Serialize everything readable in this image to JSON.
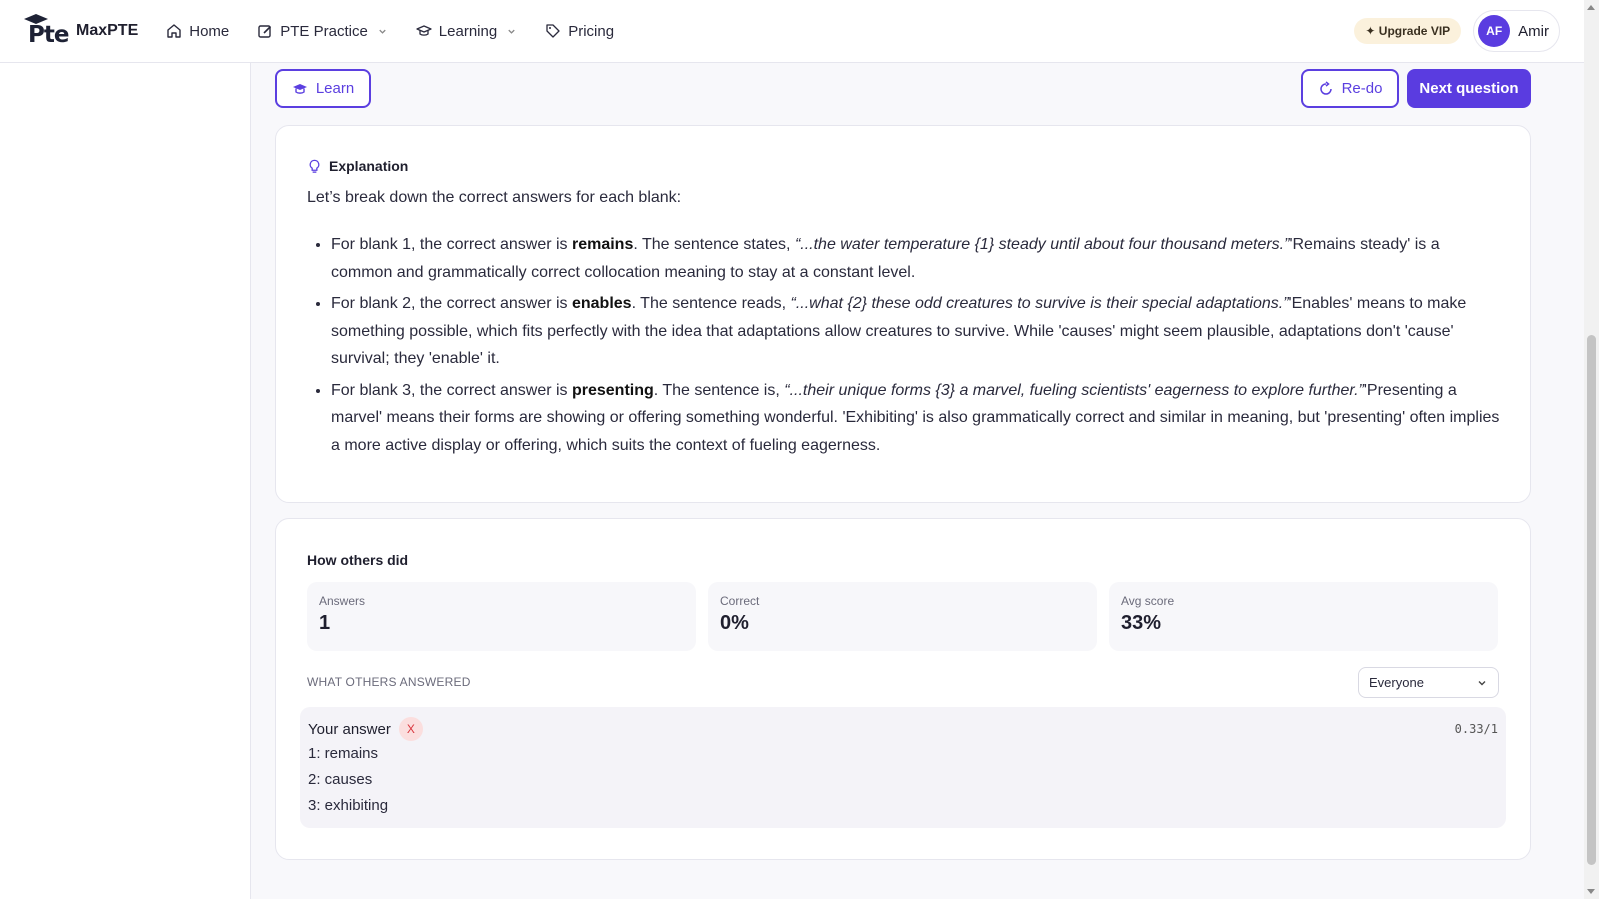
{
  "nav": {
    "brand": "MaxPTE",
    "logo_text": "Pte",
    "links": [
      {
        "label": "Home",
        "icon": "home-icon"
      },
      {
        "label": "PTE Practice",
        "icon": "edit-icon"
      },
      {
        "label": "Learning",
        "icon": "graduation-cap-icon"
      },
      {
        "label": "Pricing",
        "icon": "tag-icon"
      }
    ],
    "upgrade_label": "✦ Upgrade VIP",
    "avatar_initials": "AF",
    "user_name": "Amir"
  },
  "actions": {
    "learn_label": "Learn",
    "redo_label": "Re-do",
    "next_label": "Next question"
  },
  "explanation": {
    "title": "Explanation",
    "intro": "Let’s break down the correct answers for each blank:",
    "items": [
      {
        "pre": "For blank 1, the correct answer is ",
        "answer": "remains",
        "mid": ". The sentence states, ",
        "quote": "“...the water temperature {1} steady until about four thousand meters.”",
        "post": "'Remains steady' is a common and grammatically correct collocation meaning to stay at a constant level."
      },
      {
        "pre": "For blank 2, the correct answer is ",
        "answer": "enables",
        "mid": ". The sentence reads, ",
        "quote": "“...what {2} these odd creatures to survive is their special adaptations.”",
        "post": "'Enables' means to make something possible, which fits perfectly with the idea that adaptations allow creatures to survive. While 'causes' might seem plausible, adaptations don't 'cause' survival; they 'enable' it."
      },
      {
        "pre": "For blank 3, the correct answer is ",
        "answer": "presenting",
        "mid": ". The sentence is, ",
        "quote": "“...their unique forms {3} a marvel, fueling scientists' eagerness to explore further.”",
        "post": "'Presenting a marvel' means their forms are showing or offering something wonderful. 'Exhibiting' is also grammatically correct and similar in meaning, but 'presenting' often implies a more active display or offering, which suits the context of fueling eagerness."
      }
    ]
  },
  "stats": {
    "title": "How others did",
    "cards": [
      {
        "label": "Answers",
        "value": "1"
      },
      {
        "label": "Correct",
        "value": "0%"
      },
      {
        "label": "Avg score",
        "value": "33%"
      }
    ],
    "what_others_label": "WHAT OTHERS ANSWERED",
    "filter_value": "Everyone"
  },
  "your_answer": {
    "label": "Your answer",
    "status_mark": "X",
    "score": "0.33/1",
    "lines": [
      "1: remains",
      "2: causes",
      "3: exhibiting"
    ]
  }
}
